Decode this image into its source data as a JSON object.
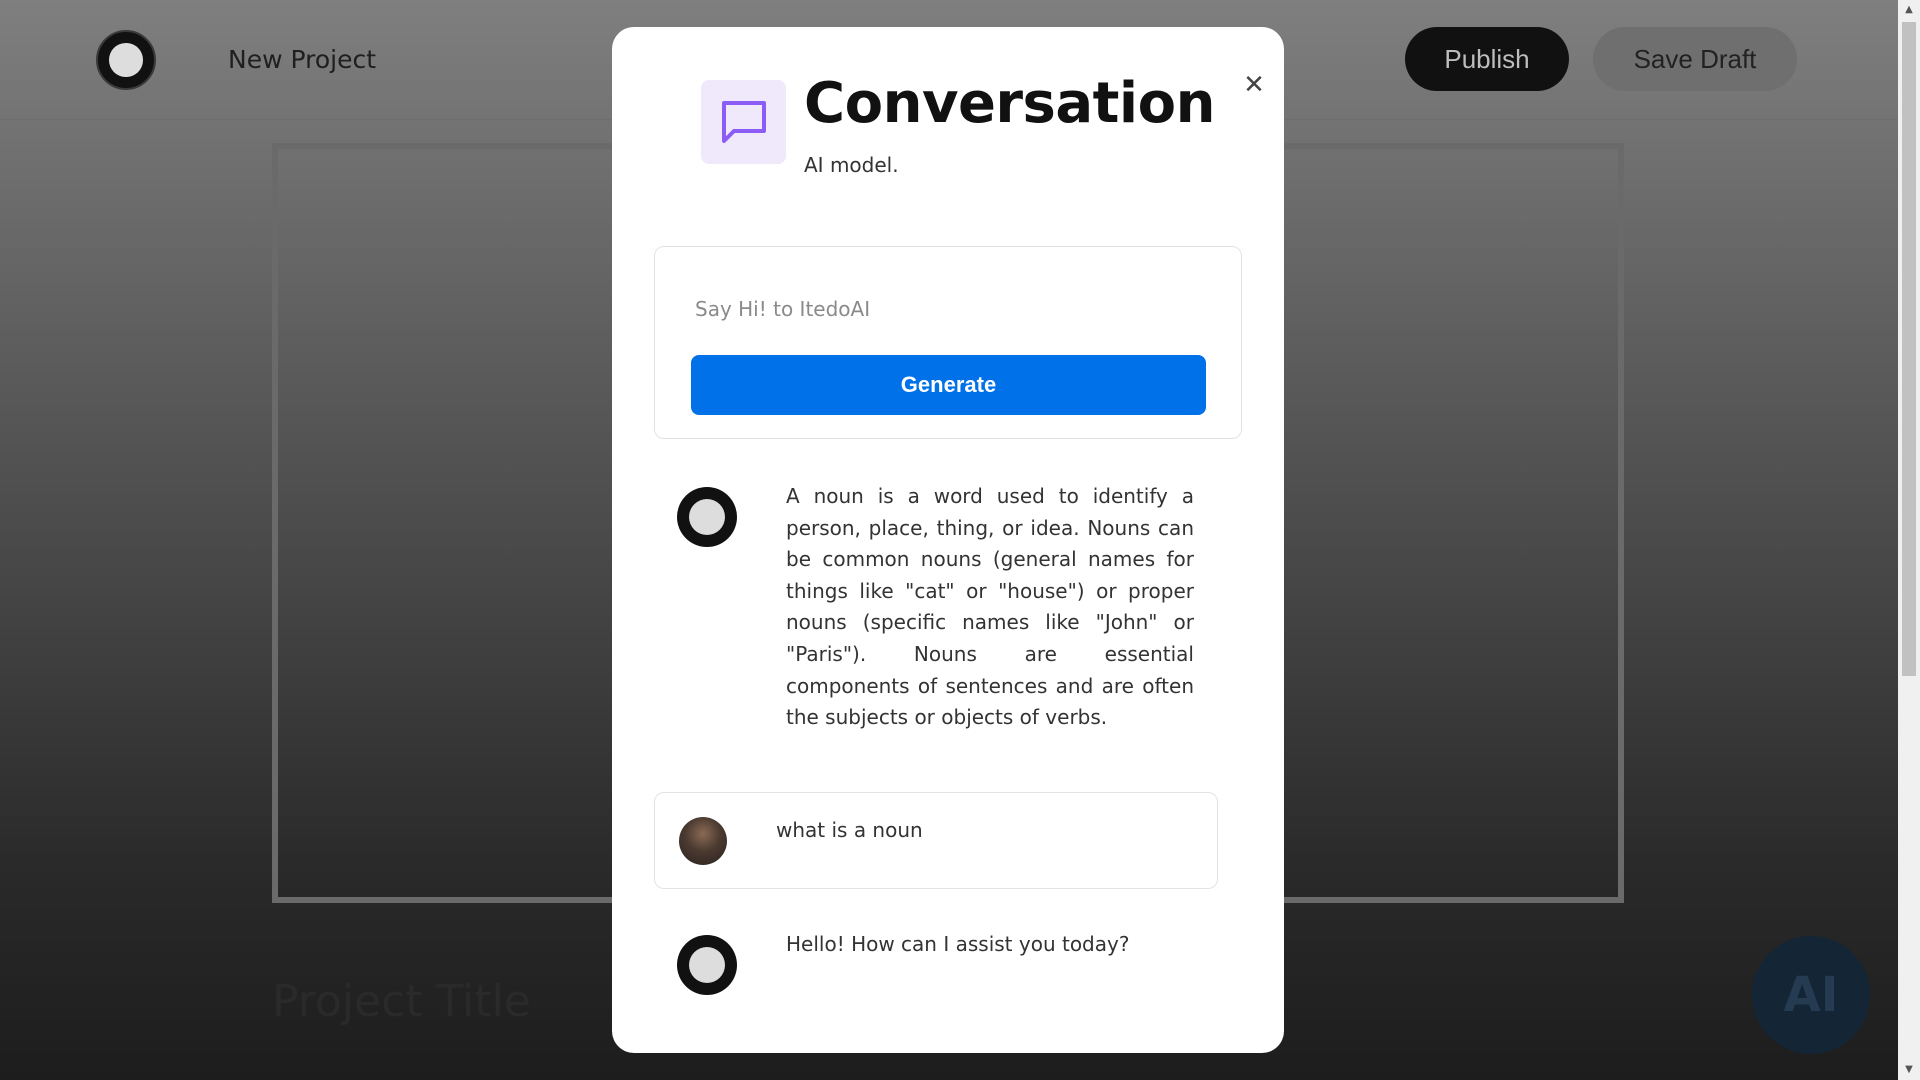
{
  "topbar": {
    "project_name": "New Project",
    "publish_label": "Publish",
    "save_draft_label": "Save Draft"
  },
  "background": {
    "project_title": "Project Title"
  },
  "modal": {
    "title": "Conversation",
    "subtitle": "AI model.",
    "close_icon": "close-icon",
    "header_icon": "chat-bubble-icon",
    "accent_color": "#8b5cf6",
    "prompt_placeholder": "Say Hi! to ItedoAI",
    "prompt_value": "",
    "generate_label": "Generate",
    "generate_color": "#0071e8"
  },
  "messages": [
    {
      "role": "assistant",
      "text": "A noun is a word used to identify a person, place, thing, or idea. Nouns can be common nouns (general names for things like \"cat\" or \"house\") or proper nouns (specific names like \"John\" or \"Paris\"). Nouns are essential components of sentences and are often the subjects or objects of verbs."
    },
    {
      "role": "user",
      "text": "what is a noun"
    },
    {
      "role": "assistant",
      "text": "Hello! How can I assist you today?"
    }
  ]
}
